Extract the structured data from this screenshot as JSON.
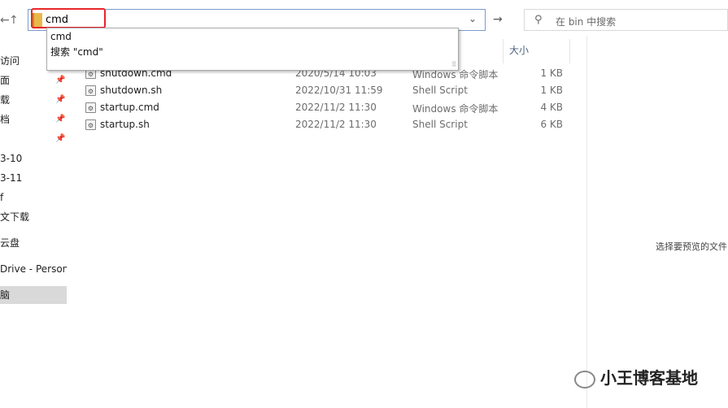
{
  "address_bar": {
    "value": "cmd"
  },
  "search": {
    "placeholder": "在 bin 中搜索",
    "icon": "search-icon"
  },
  "suggestions": [
    "cmd",
    "搜索 \"cmd\""
  ],
  "sidebar": {
    "items": [
      {
        "label": "访问"
      },
      {
        "label": "面"
      },
      {
        "label": "载"
      },
      {
        "label": "档"
      },
      {
        "label": ""
      },
      {
        "label": "3-10"
      },
      {
        "label": "3-11"
      },
      {
        "label": "f"
      },
      {
        "label": "文下载"
      },
      {
        "label": "云盘"
      },
      {
        "label": "Drive - Persona"
      },
      {
        "label": "脑"
      }
    ]
  },
  "columns": {
    "size": "大小"
  },
  "files": [
    {
      "name": "shutdown.cmd",
      "date": "2020/5/14 10:03",
      "type": "Windows 命令脚本",
      "size": "1 KB"
    },
    {
      "name": "shutdown.sh",
      "date": "2022/10/31 11:59",
      "type": "Shell Script",
      "size": "1 KB"
    },
    {
      "name": "startup.cmd",
      "date": "2022/11/2 11:30",
      "type": "Windows 命令脚本",
      "size": "4 KB"
    },
    {
      "name": "startup.sh",
      "date": "2022/11/2 11:30",
      "type": "Shell Script",
      "size": "6 KB"
    }
  ],
  "preview": {
    "message": "选择要预览的文件"
  },
  "watermark": {
    "text": "小王博客基地"
  }
}
